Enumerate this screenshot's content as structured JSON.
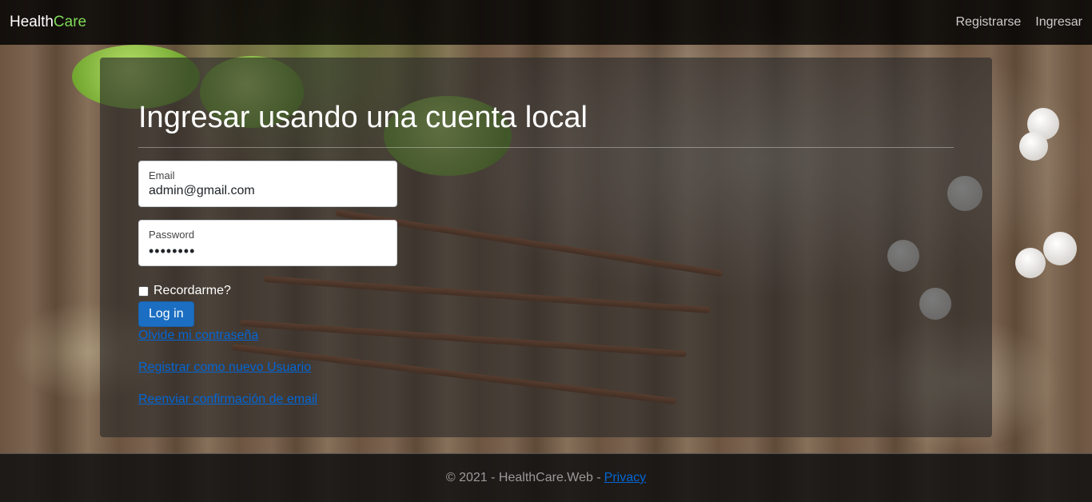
{
  "brand": {
    "prefix": "Health",
    "accent": "Care"
  },
  "nav": {
    "register": "Registrarse",
    "login": "Ingresar"
  },
  "form": {
    "title": "Ingresar usando una cuenta local",
    "email_label": "Email",
    "email_value": "admin@gmail.com",
    "password_label": "Password",
    "password_value": "••••••••",
    "remember_label": "Recordarme?",
    "remember_checked": false,
    "submit_label": "Log in"
  },
  "links": {
    "forgot": "Olvide mi contraseña",
    "register": "Registrar como nuevo Usuario",
    "resend": "Reenviar confirmación de email"
  },
  "footer": {
    "copyright": "© 2021 - HealthCare.Web -",
    "privacy": "Privacy"
  },
  "colors": {
    "accent_green": "#7ed957",
    "primary_button": "#1b6ec2",
    "link": "#0366d6"
  }
}
